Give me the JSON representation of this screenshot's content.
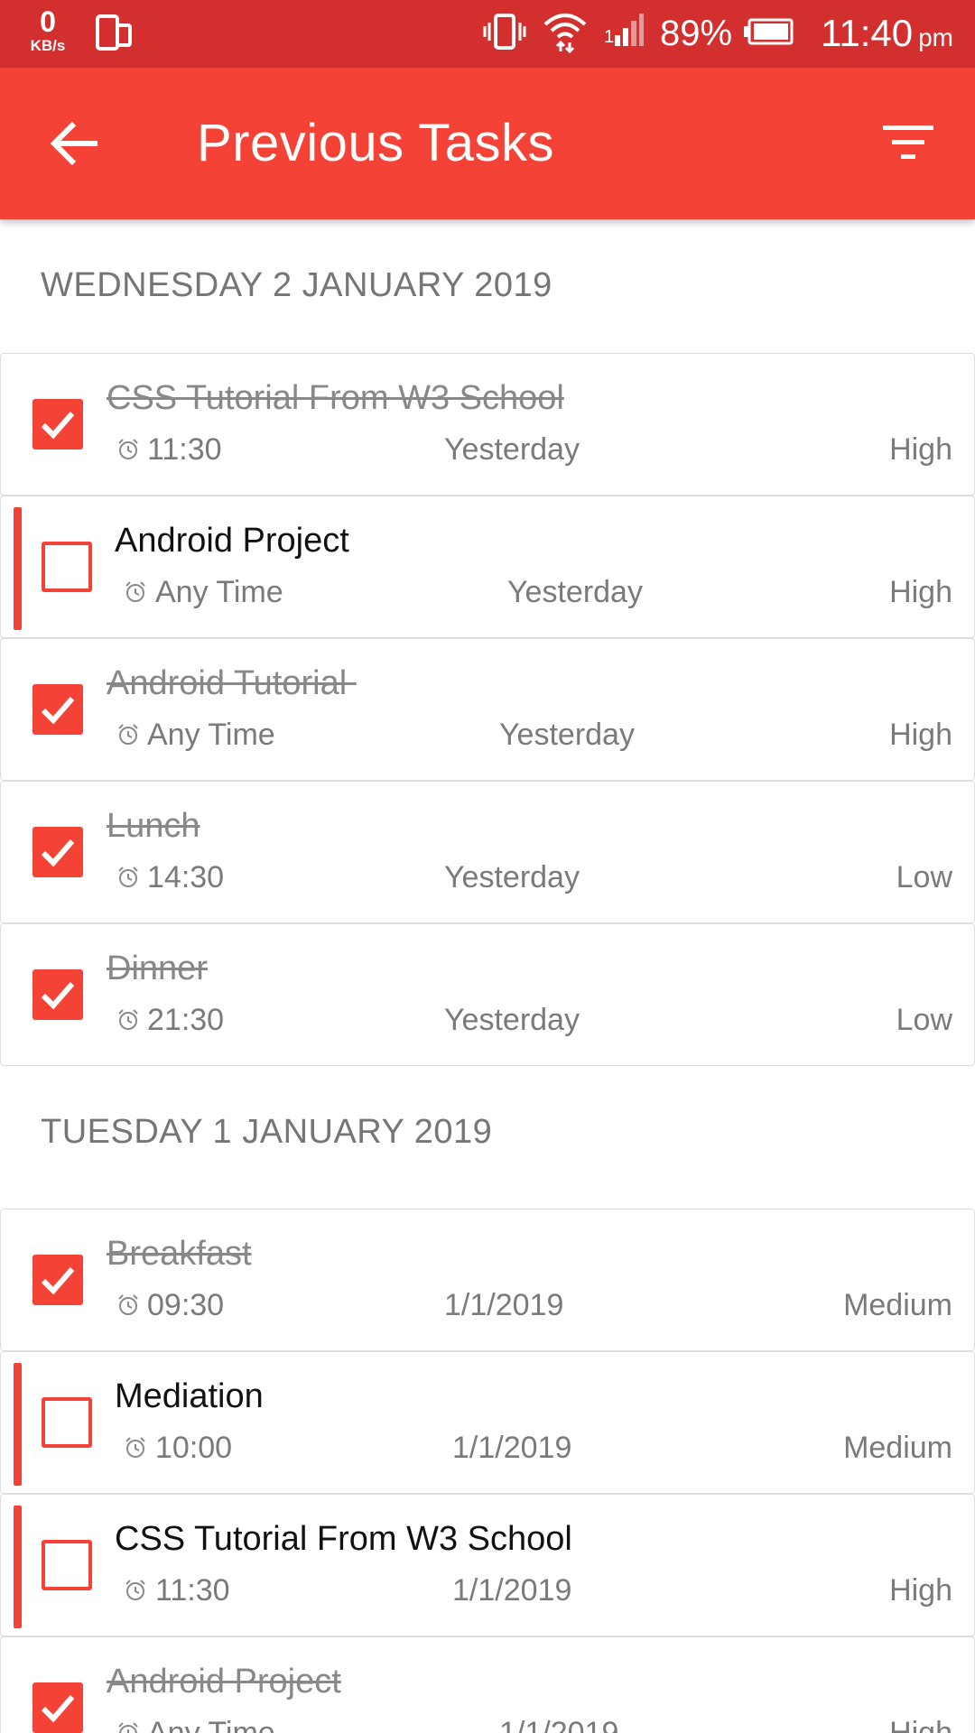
{
  "status_bar": {
    "speed_value": "0",
    "speed_unit": "KB/s",
    "battery_percent": "89%",
    "time": "11:40",
    "ampm": "pm"
  },
  "app_bar": {
    "title": "Previous Tasks"
  },
  "sections": [
    {
      "header": "WEDNESDAY 2 JANUARY 2019",
      "tasks": [
        {
          "title": "CSS Tutorial From W3 School",
          "time": "11:30",
          "date": "Yesterday",
          "priority": "High",
          "done": true
        },
        {
          "title": "Android Project",
          "time": "Any Time",
          "date": "Yesterday",
          "priority": "High",
          "done": false
        },
        {
          "title": "Android Tutorial ",
          "time": "Any Time",
          "date": "Yesterday",
          "priority": "High",
          "done": true
        },
        {
          "title": "Lunch",
          "time": "14:30",
          "date": "Yesterday",
          "priority": "Low",
          "done": true
        },
        {
          "title": "Dinner",
          "time": "21:30",
          "date": "Yesterday",
          "priority": "Low",
          "done": true
        }
      ]
    },
    {
      "header": "TUESDAY 1 JANUARY 2019",
      "tasks": [
        {
          "title": "Breakfast",
          "time": "09:30",
          "date": "1/1/2019",
          "priority": "Medium",
          "done": true
        },
        {
          "title": "Mediation",
          "time": "10:00",
          "date": "1/1/2019",
          "priority": "Medium",
          "done": false
        },
        {
          "title": "CSS Tutorial From W3 School",
          "time": "11:30",
          "date": "1/1/2019",
          "priority": "High",
          "done": false
        },
        {
          "title": "Android Project",
          "time": "Any Time",
          "date": "1/1/2019",
          "priority": "High",
          "done": true
        }
      ]
    }
  ],
  "colors": {
    "status_bar": "#d32f2f",
    "app_bar": "#f44336",
    "accent": "#f44336"
  },
  "icons": {
    "back": "arrow-left-icon",
    "filter": "filter-icon",
    "alarm": "alarm-clock-icon",
    "check": "checkmark-icon"
  }
}
